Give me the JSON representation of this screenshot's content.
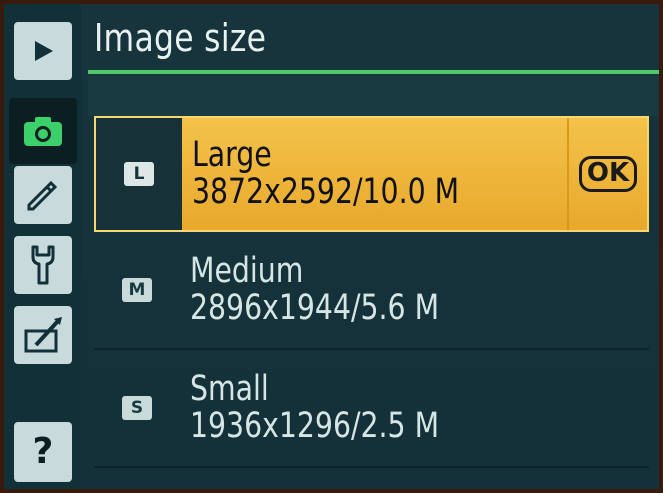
{
  "header": {
    "title": "Image size"
  },
  "sidebar": {
    "tabs": [
      {
        "name": "playback",
        "icon": "play-icon"
      },
      {
        "name": "shooting",
        "icon": "camera-icon",
        "active": true
      },
      {
        "name": "custom-settings",
        "icon": "pencil-icon"
      },
      {
        "name": "setup",
        "icon": "wrench-icon"
      },
      {
        "name": "retouch",
        "icon": "retouch-brush-icon"
      },
      {
        "name": "help",
        "icon": "help-icon",
        "label": "?"
      }
    ]
  },
  "options": [
    {
      "icon_label": "L",
      "name": "Large",
      "detail": "3872x2592/10.0 M",
      "selected": true,
      "confirm_label": "OK"
    },
    {
      "icon_label": "M",
      "name": "Medium",
      "detail": "2896x1944/5.6 M",
      "selected": false
    },
    {
      "icon_label": "S",
      "name": "Small",
      "detail": "1936x1296/2.5 M",
      "selected": false
    }
  ],
  "colors": {
    "background": "#17343c",
    "accent_rule": "#52c86c",
    "highlight": "#f0b83a",
    "text": "#d6e6e4"
  }
}
